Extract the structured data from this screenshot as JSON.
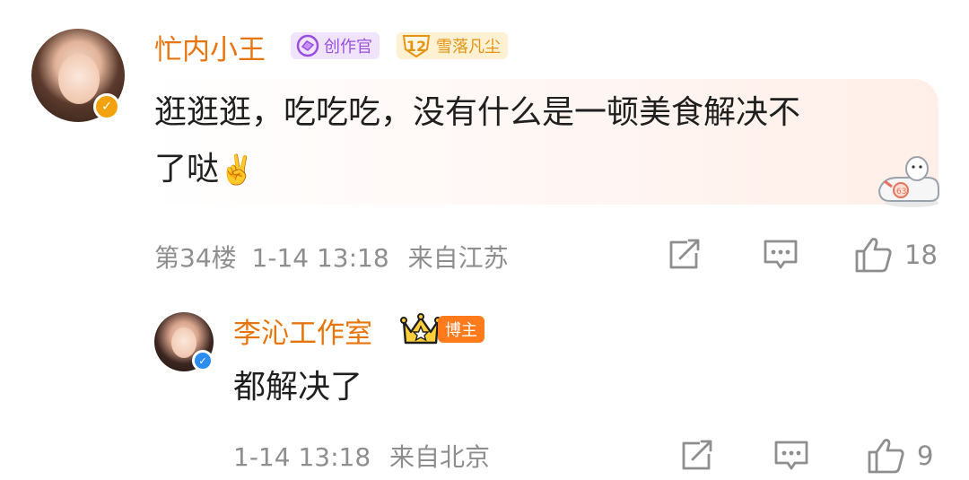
{
  "comment": {
    "username": "忙内小王",
    "badges": {
      "creator": "创作官",
      "level_number": "12",
      "level_name": "雪落凡尘"
    },
    "text_line1": "逛逛逛，吃吃吃，没有什么是一顿美食解决不",
    "text_line2": "了哒",
    "emoji": "✌️",
    "floor": "第34楼",
    "timestamp": "1-14 13:18",
    "location": "来自江苏",
    "like_count": "18"
  },
  "reply": {
    "username": "李沁工作室",
    "badge": "博主",
    "text": "都解决了",
    "timestamp": "1-14 13:18",
    "location": "来自北京",
    "like_count": "9"
  },
  "icons": {
    "share": "share-icon",
    "comment": "comment-icon",
    "like": "thumbs-up-icon",
    "verified": "verified-badge-icon",
    "crown": "crown-icon"
  },
  "colors": {
    "username": "#e8750c",
    "meta": "#8e8e8e",
    "verified_gold": "#f2a20c",
    "verified_blue": "#2d8cf0",
    "host_badge": "#ff7a1a"
  }
}
